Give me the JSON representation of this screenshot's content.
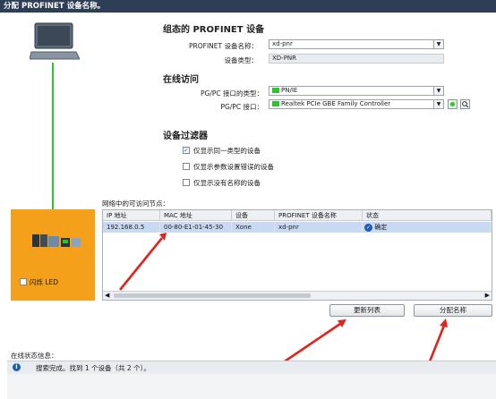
{
  "window": {
    "title": "分配 PROFINET 设备名称。"
  },
  "config": {
    "heading": "组态的 PROFINET 设备",
    "device_name_label": "PROFINET 设备名称：",
    "device_name_value": "xd-pnr",
    "device_type_label": "设备类型：",
    "device_type_value": "XD-PNR"
  },
  "online": {
    "heading": "在线访问",
    "iface_type_label": "PG/PC 接口的类型：",
    "iface_type_value": "PN/IE",
    "iface_label": "PG/PC 接口：",
    "iface_value": "Realtek PCIe GBE Family Controller"
  },
  "filter": {
    "heading": "设备过滤器",
    "opt1": "仅显示同一类型的设备",
    "opt1_checked": true,
    "opt2": "仅显示参数设置错误的设备",
    "opt3": "仅显示没有名称的设备"
  },
  "nodes": {
    "caption": "网络中的可访问节点：",
    "columns": [
      "IP 地址",
      "MAC 地址",
      "设备",
      "PROFINET 设备名称",
      "状态"
    ],
    "rows": [
      {
        "ip": "192.168.0.5",
        "mac": "00-80-E1-01-45-30",
        "device": "Xone",
        "name": "xd-pnr",
        "status": "确定"
      }
    ]
  },
  "left_panel": {
    "flash_label": "闪烁 LED"
  },
  "buttons": {
    "refresh": "更新列表",
    "assign": "分配名称"
  },
  "status": {
    "label": "在线状态信息：",
    "message": "搜索完成。找到 1 个设备（共 2 个）。"
  },
  "colors": {
    "accent": "#f5a01a",
    "titlebar": "#2e3e55",
    "selection": "#c9d9f2",
    "arrow": "#e0231b",
    "link": "#2fc42f"
  }
}
